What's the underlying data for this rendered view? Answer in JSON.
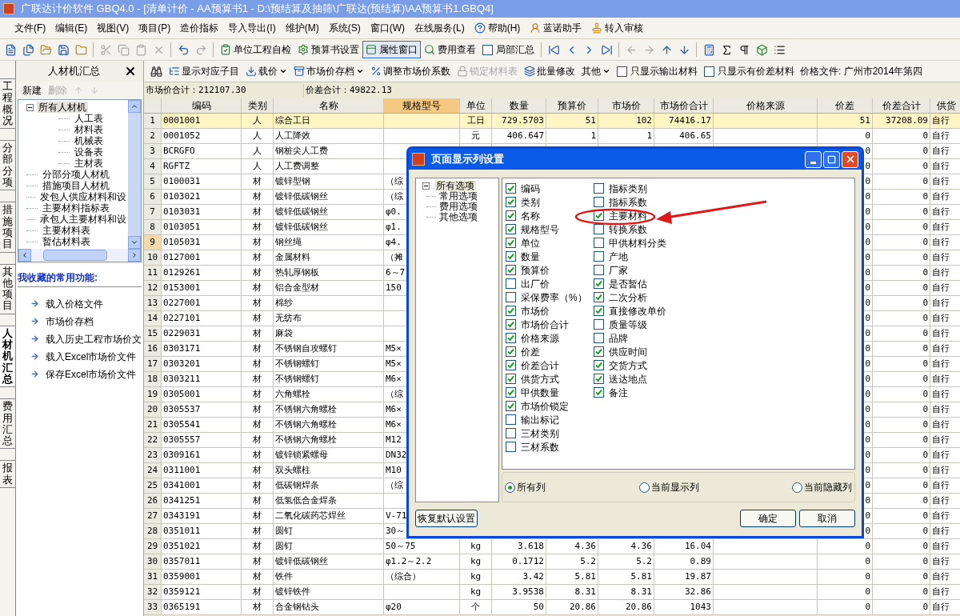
{
  "window": {
    "title": "广联达计价软件 GBQ4.0 - [清单计价 - AA预算书1 - D:\\预结算及抽筛\\广联达(预结算)\\AA预算书1.GBQ4]"
  },
  "menu": [
    {
      "kind": "text",
      "label": "文件(F)"
    },
    {
      "kind": "text",
      "label": "编辑(E)"
    },
    {
      "kind": "text",
      "label": "视图(V)"
    },
    {
      "kind": "text",
      "label": "项目(P)"
    },
    {
      "kind": "text",
      "label": "造价指标"
    },
    {
      "kind": "text",
      "label": "导入导出(I)"
    },
    {
      "kind": "text",
      "label": "维护(M)"
    },
    {
      "kind": "text",
      "label": "系统(S)"
    },
    {
      "kind": "text",
      "label": "窗口(W)"
    },
    {
      "kind": "text",
      "label": "在线服务(L)"
    },
    {
      "kind": "help",
      "label": "帮助(H)"
    },
    {
      "kind": "assistant",
      "label": "蓝诺助手"
    },
    {
      "kind": "review",
      "label": "转入审核"
    }
  ],
  "toolbar": [
    {
      "kind": "button",
      "label": "单位工程自检",
      "pressed": false
    },
    {
      "kind": "button",
      "label": "预算书设置",
      "pressed": false
    },
    {
      "kind": "button",
      "label": "属性窗口",
      "pressed": true
    },
    {
      "kind": "button",
      "label": "费用查看",
      "pressed": false
    },
    {
      "kind": "checkbox",
      "label": "局部汇总",
      "checked": false
    }
  ],
  "side_tabs": [
    {
      "label": "工程概况",
      "selected": false
    },
    {
      "label": "分部分项",
      "selected": false
    },
    {
      "label": "措施项目",
      "selected": false
    },
    {
      "label": "其他项目",
      "selected": false
    },
    {
      "label": "人材机汇总",
      "selected": true
    },
    {
      "label": "费用汇总",
      "selected": false
    },
    {
      "label": "报表",
      "selected": false
    }
  ],
  "panel": {
    "title": "人材机汇总",
    "actions": [
      {
        "label": "新建",
        "disabled": false
      },
      {
        "label": "删除",
        "disabled": true
      }
    ],
    "tree": [
      {
        "label": "所有人材机",
        "expanded": true,
        "selected": true,
        "children": [
          {
            "label": "人工表",
            "selected": false
          },
          {
            "label": "材料表",
            "selected": false
          },
          {
            "label": "机械表",
            "selected": false
          },
          {
            "label": "设备表",
            "selected": false
          },
          {
            "label": "主材表",
            "selected": false
          }
        ]
      },
      {
        "label": "分部分项人材机",
        "selected": false
      },
      {
        "label": "措施项目人材机",
        "selected": false
      },
      {
        "label": "发包人供应材料和设",
        "selected": false
      },
      {
        "label": "主要材料指标表",
        "selected": false
      },
      {
        "label": "承包人主要材料和设",
        "selected": false
      },
      {
        "label": "主要材料表",
        "selected": false
      },
      {
        "label": "暂估材料表",
        "selected": false
      }
    ],
    "favorites_title": "我收藏的常用功能:",
    "favorites": [
      "载入价格文件",
      "市场价存档",
      "载入历史工程市场价文",
      "载入Excel市场价文件",
      "保存Excel市场价文件"
    ]
  },
  "toolbar2": [
    {
      "kind": "button",
      "label": "显示对应子目",
      "disabled": false
    },
    {
      "kind": "dropdown",
      "label": "载价",
      "disabled": false
    },
    {
      "kind": "dropdown",
      "label": "市场价存档",
      "disabled": false
    },
    {
      "kind": "button",
      "label": "调整市场价系数",
      "disabled": false
    },
    {
      "kind": "button",
      "label": "锁定材料表",
      "disabled": true
    },
    {
      "kind": "button",
      "label": "批量修改",
      "disabled": false
    },
    {
      "kind": "dropdown",
      "label": "其他",
      "disabled": false
    },
    {
      "kind": "checkbox",
      "label": "只显示输出材料",
      "checked": false
    },
    {
      "kind": "checkbox",
      "label": "只显示有价差材料",
      "checked": false
    },
    {
      "kind": "text",
      "label": "价格文件: 广州市2014年第四"
    }
  ],
  "totals": [
    "市场价合计：212107.30",
    "价差合计：49822.13"
  ],
  "table": {
    "columns": [
      {
        "label": "编码",
        "selected": false
      },
      {
        "label": "类别",
        "selected": false
      },
      {
        "label": "名称",
        "selected": false
      },
      {
        "label": "规格型号",
        "selected": true
      },
      {
        "label": "单位",
        "selected": false
      },
      {
        "label": "数量",
        "selected": false
      },
      {
        "label": "预算价",
        "selected": false
      },
      {
        "label": "市场价",
        "selected": false
      },
      {
        "label": "市场价合计",
        "selected": false
      },
      {
        "label": "价格来源",
        "selected": false
      },
      {
        "label": "价差",
        "selected": false
      },
      {
        "label": "价差合计",
        "selected": false
      },
      {
        "label": "供货",
        "selected": false
      }
    ],
    "rows": [
      {
        "no": "1",
        "selected": true,
        "focused": false,
        "code": "0001001",
        "type": "人",
        "name": "综合工日",
        "unit": "工日",
        "qty": "729.5703",
        "budget": "51",
        "market": "102",
        "market_total": "74416.17",
        "diff": "51",
        "diff_total": "37208.09",
        "supply": "自行"
      },
      {
        "no": "2",
        "selected": false,
        "focused": false,
        "code": "0001052",
        "type": "人",
        "name": "人工降效",
        "unit": "元",
        "qty": "406.647",
        "budget": "1",
        "market": "1",
        "market_total": "406.65",
        "diff": "0",
        "diff_total": "0",
        "supply": "自行"
      },
      {
        "no": "3",
        "selected": false,
        "focused": false,
        "code": "BCRGFO",
        "type": "人",
        "name": "钢桩尖人工费",
        "diff": "0",
        "diff_total": "0",
        "supply": "自行"
      },
      {
        "no": "4",
        "selected": false,
        "focused": false,
        "code": "RGFTZ",
        "type": "人",
        "name": "人工费调整",
        "diff": "0",
        "diff_total": "0",
        "supply": "自行"
      },
      {
        "no": "5",
        "selected": false,
        "focused": false,
        "code": "0100031",
        "type": "材",
        "name": "镀锌型钢",
        "spec": "（综",
        "diff": "0",
        "diff_total": "0",
        "supply": "自行"
      },
      {
        "no": "6",
        "selected": false,
        "focused": false,
        "code": "0103021",
        "type": "材",
        "name": "镀锌低碳钢丝",
        "spec": "（综",
        "diff": "0",
        "diff_total": "0",
        "supply": "自行"
      },
      {
        "no": "7",
        "selected": false,
        "focused": false,
        "code": "0103031",
        "type": "材",
        "name": "镀锌低碳钢丝",
        "spec": "φ0.",
        "diff": "0",
        "diff_total": "0",
        "supply": "自行"
      },
      {
        "no": "8",
        "selected": false,
        "focused": false,
        "code": "0103051",
        "type": "材",
        "name": "镀锌低碳钢丝",
        "spec": "φ1.",
        "diff": "0",
        "diff_total": "0",
        "supply": "自行"
      },
      {
        "no": "9",
        "selected": false,
        "focused": true,
        "code": "0105031",
        "type": "材",
        "name": "钢丝绳",
        "spec": "φ4.",
        "diff": "0",
        "diff_total": "0",
        "supply": "自行"
      },
      {
        "no": "10",
        "selected": false,
        "focused": false,
        "code": "0127001",
        "type": "材",
        "name": "金属材料",
        "spec": "（摊",
        "diff": "0",
        "diff_total": "0",
        "supply": "自行"
      },
      {
        "no": "11",
        "selected": false,
        "focused": false,
        "code": "0129261",
        "type": "材",
        "name": "热轧厚钢板",
        "spec": "6～7",
        "diff": "0",
        "diff_total": "0",
        "supply": "自行"
      },
      {
        "no": "12",
        "selected": false,
        "focused": false,
        "code": "0153001",
        "type": "材",
        "name": "铝合金型材",
        "spec": "150",
        "diff": "0",
        "diff_total": "0",
        "supply": "自行"
      },
      {
        "no": "13",
        "selected": false,
        "focused": false,
        "code": "0227001",
        "type": "材",
        "name": "棉纱",
        "diff": "0",
        "diff_total": "0",
        "supply": "自行"
      },
      {
        "no": "14",
        "selected": false,
        "focused": false,
        "code": "0227101",
        "type": "材",
        "name": "无纺布",
        "diff": "0",
        "diff_total": "0",
        "supply": "自行"
      },
      {
        "no": "15",
        "selected": false,
        "focused": false,
        "code": "0229031",
        "type": "材",
        "name": "麻袋",
        "diff": "0",
        "diff_total": "0",
        "supply": "自行"
      },
      {
        "no": "16",
        "selected": false,
        "focused": false,
        "code": "0303171",
        "type": "材",
        "name": "不锈钢自攻螺钉",
        "spec": "M5×",
        "diff": "0",
        "diff_total": "0",
        "supply": "自行"
      },
      {
        "no": "17",
        "selected": false,
        "focused": false,
        "code": "0303201",
        "type": "材",
        "name": "不锈钢螺钉",
        "spec": "M5×",
        "diff": "0",
        "diff_total": "0",
        "supply": "自行"
      },
      {
        "no": "18",
        "selected": false,
        "focused": false,
        "code": "0303211",
        "type": "材",
        "name": "不锈钢螺钉",
        "spec": "M6×",
        "diff": "0",
        "diff_total": "0",
        "supply": "自行"
      },
      {
        "no": "19",
        "selected": false,
        "focused": false,
        "code": "0305001",
        "type": "材",
        "name": "六角螺栓",
        "spec": "（综",
        "diff": "0",
        "diff_total": "0",
        "supply": "自行"
      },
      {
        "no": "20",
        "selected": false,
        "focused": false,
        "code": "0305537",
        "type": "材",
        "name": "不锈钢六角螺栓",
        "spec": "M6×",
        "diff": "0",
        "diff_total": "0",
        "supply": "自行"
      },
      {
        "no": "21",
        "selected": false,
        "focused": false,
        "code": "0305541",
        "type": "材",
        "name": "不锈钢六角螺栓",
        "spec": "M6×",
        "diff": "0",
        "diff_total": "0",
        "supply": "自行"
      },
      {
        "no": "22",
        "selected": false,
        "focused": false,
        "code": "0305557",
        "type": "材",
        "name": "不锈钢六角螺栓",
        "spec": "M12",
        "diff": "0",
        "diff_total": "0",
        "supply": "自行"
      },
      {
        "no": "23",
        "selected": false,
        "focused": false,
        "code": "0309161",
        "type": "材",
        "name": "镀锌锁紧螺母",
        "spec": "DN32",
        "diff": "0",
        "diff_total": "0",
        "supply": "自行"
      },
      {
        "no": "24",
        "selected": false,
        "focused": false,
        "code": "0311001",
        "type": "材",
        "name": "双头螺柱",
        "spec": "M10",
        "diff": "0",
        "diff_total": "0",
        "supply": "自行"
      },
      {
        "no": "25",
        "selected": false,
        "focused": false,
        "code": "0341001",
        "type": "材",
        "name": "低碳钢焊条",
        "spec": "（综",
        "diff": "0",
        "diff_total": "0",
        "supply": "自行"
      },
      {
        "no": "26",
        "selected": false,
        "focused": false,
        "code": "0341251",
        "type": "材",
        "name": "低氢低合金焊条",
        "diff": "0",
        "diff_total": "0",
        "supply": "自行"
      },
      {
        "no": "27",
        "selected": false,
        "focused": false,
        "code": "0343191",
        "type": "材",
        "name": "二氧化碳药芯焊丝",
        "spec": "V-71",
        "diff": "0",
        "diff_total": "0",
        "supply": "自行"
      },
      {
        "no": "28",
        "selected": false,
        "focused": false,
        "code": "0351011",
        "type": "材",
        "name": "圆钉",
        "spec": "30～",
        "diff": "0",
        "diff_total": "0",
        "supply": "自行"
      },
      {
        "no": "29",
        "selected": false,
        "focused": false,
        "code": "0351021",
        "type": "材",
        "name": "圆钉",
        "spec": "50～75",
        "unit": "kg",
        "qty": "3.618",
        "budget": "4.36",
        "market": "4.36",
        "market_total": "16.04",
        "diff": "0",
        "diff_total": "0",
        "supply": "自行"
      },
      {
        "no": "30",
        "selected": false,
        "focused": false,
        "code": "0357011",
        "type": "材",
        "name": "镀锌低碳钢丝",
        "spec": "φ1.2～2.2",
        "unit": "kg",
        "qty": "0.1712",
        "budget": "5.2",
        "market": "5.2",
        "market_total": "0.89",
        "diff": "0",
        "diff_total": "0",
        "supply": "自行"
      },
      {
        "no": "31",
        "selected": false,
        "focused": false,
        "code": "0359001",
        "type": "材",
        "name": "铁件",
        "spec": "（综合）",
        "unit": "kg",
        "qty": "3.42",
        "budget": "5.81",
        "market": "5.81",
        "market_total": "19.87",
        "diff": "0",
        "diff_total": "0",
        "supply": "自行"
      },
      {
        "no": "32",
        "selected": false,
        "focused": false,
        "code": "0359121",
        "type": "材",
        "name": "镀锌铁件",
        "unit": "kg",
        "qty": "3.9538",
        "budget": "8.31",
        "market": "8.31",
        "market_total": "32.86",
        "diff": "0",
        "diff_total": "0",
        "supply": "自行"
      },
      {
        "no": "33",
        "selected": false,
        "focused": false,
        "code": "0365191",
        "type": "材",
        "name": "合金钢钻头",
        "spec": "φ20",
        "unit": "个",
        "qty": "50",
        "budget": "20.86",
        "market": "20.86",
        "market_total": "1043",
        "diff": "0",
        "diff_total": "0",
        "supply": "自行"
      }
    ]
  },
  "dialog": {
    "title": "页面显示列设置",
    "tree": [
      {
        "label": "所有选项",
        "expanded": true,
        "selected": true,
        "children": [
          {
            "label": "常用选项",
            "selected": false
          },
          {
            "label": "费用选项",
            "selected": false
          },
          {
            "label": "其他选项",
            "selected": false
          }
        ]
      }
    ],
    "options": [
      [
        {
          "label": "编码",
          "checked": true
        },
        {
          "label": "类别",
          "checked": true
        },
        {
          "label": "名称",
          "checked": true
        },
        {
          "label": "规格型号",
          "checked": true
        },
        {
          "label": "单位",
          "checked": true
        },
        {
          "label": "数量",
          "checked": true
        },
        {
          "label": "预算价",
          "checked": true
        },
        {
          "label": "出厂价",
          "checked": false
        },
        {
          "label": "采保费率（%）",
          "checked": false
        },
        {
          "label": "市场价",
          "checked": true
        },
        {
          "label": "市场价合计",
          "checked": true
        },
        {
          "label": "价格来源",
          "checked": true
        },
        {
          "label": "价差",
          "checked": true
        },
        {
          "label": "价差合计",
          "checked": true
        },
        {
          "label": "供货方式",
          "checked": true
        },
        {
          "label": "甲供数量",
          "checked": true
        },
        {
          "label": "市场价锁定",
          "checked": true
        },
        {
          "label": "输出标记",
          "checked": false
        },
        {
          "label": "三材类别",
          "checked": false
        },
        {
          "label": "三材系数",
          "checked": false
        }
      ],
      [
        {
          "label": "指标类别",
          "checked": false
        },
        {
          "label": "指标系数",
          "checked": false
        },
        {
          "label": "主要材料",
          "checked": true
        },
        {
          "label": "转换系数",
          "checked": false
        },
        {
          "label": "甲供材料分类",
          "checked": false
        },
        {
          "label": "产地",
          "checked": false
        },
        {
          "label": "厂家",
          "checked": false
        },
        {
          "label": "是否暂估",
          "checked": true
        },
        {
          "label": "二次分析",
          "checked": true
        },
        {
          "label": "直接修改单价",
          "checked": true
        },
        {
          "label": "质量等级",
          "checked": false
        },
        {
          "label": "品牌",
          "checked": false
        },
        {
          "label": "供应时间",
          "checked": true
        },
        {
          "label": "交货方式",
          "checked": true
        },
        {
          "label": "送达地点",
          "checked": true
        },
        {
          "label": "备注",
          "checked": true
        }
      ]
    ],
    "filters": [
      {
        "label": "所有列",
        "selected": true
      },
      {
        "label": "当前显示列",
        "selected": false
      },
      {
        "label": "当前隐藏列",
        "selected": false
      }
    ],
    "reset_button": "恢复默认设置",
    "ok_button": "确定",
    "cancel_button": "取消"
  }
}
